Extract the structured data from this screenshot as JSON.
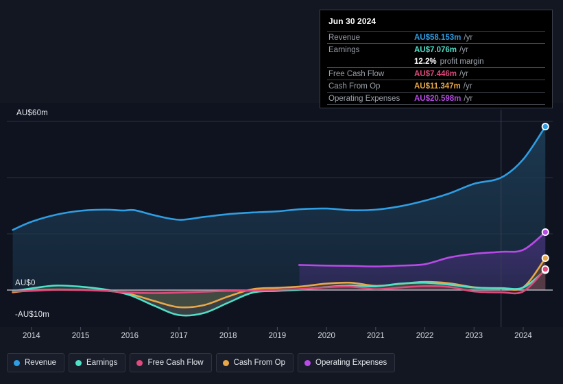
{
  "chart_data": {
    "type": "area",
    "title": "",
    "xlabel": "",
    "ylabel": "",
    "currency": "AU$",
    "unit": "m",
    "grid": true,
    "legend_position": "bottom",
    "xlim": [
      2013.5,
      2024.6
    ],
    "ylim": [
      -13,
      62
    ],
    "x_ticks": [
      "2014",
      "2015",
      "2016",
      "2017",
      "2018",
      "2019",
      "2020",
      "2021",
      "2022",
      "2023",
      "2024"
    ],
    "x_tick_values": [
      2014,
      2015,
      2016,
      2017,
      2018,
      2019,
      2020,
      2021,
      2022,
      2023,
      2024
    ],
    "y_ticks": [
      "AU$60m",
      "AU$0",
      "-AU$10m"
    ],
    "y_tick_values": [
      60,
      0,
      -10
    ],
    "gridlines": [
      60,
      40,
      20,
      0
    ],
    "forecast_divider_x": 2023.55,
    "series": [
      {
        "name": "Revenue",
        "color": "#2f9ee3",
        "fill": "#1c3a52",
        "x": [
          2013.62,
          2014.0,
          2014.5,
          2015.0,
          2015.5,
          2015.85,
          2016.1,
          2016.5,
          2017.0,
          2017.5,
          2018.0,
          2018.5,
          2019.0,
          2019.5,
          2020.0,
          2020.5,
          2021.0,
          2021.5,
          2022.0,
          2022.5,
          2023.0,
          2023.55,
          2024.0,
          2024.45
        ],
        "values": [
          21.4,
          24.3,
          26.8,
          28.2,
          28.6,
          28.3,
          28.4,
          26.6,
          25.0,
          26.0,
          27.0,
          27.6,
          28.0,
          28.8,
          29.0,
          28.4,
          28.6,
          29.8,
          31.8,
          34.4,
          37.8,
          40.0,
          46.5,
          58.153
        ]
      },
      {
        "name": "Earnings",
        "color": "#4fe0c8",
        "fill": "#2a5a58",
        "x": [
          2013.62,
          2014.0,
          2014.5,
          2015.0,
          2015.5,
          2016.0,
          2016.5,
          2017.0,
          2017.5,
          2018.0,
          2018.5,
          2019.0,
          2019.5,
          2020.0,
          2020.5,
          2021.0,
          2021.5,
          2022.0,
          2022.5,
          2023.0,
          2023.55,
          2024.0,
          2024.45
        ],
        "values": [
          -0.4,
          0.6,
          1.6,
          1.2,
          0.2,
          -1.8,
          -5.6,
          -8.9,
          -8.2,
          -4.5,
          -0.9,
          -0.3,
          0.2,
          1.1,
          1.6,
          1.3,
          2.3,
          2.6,
          1.9,
          0.9,
          0.7,
          0.9,
          7.076
        ]
      },
      {
        "name": "Free Cash Flow",
        "color": "#e04a7c",
        "fill": "#6b2a44",
        "x": [
          2013.62,
          2014.0,
          2014.5,
          2015.0,
          2015.5,
          2016.0,
          2016.5,
          2017.0,
          2017.5,
          2018.0,
          2018.5,
          2019.0,
          2019.5,
          2020.0,
          2020.5,
          2021.0,
          2021.5,
          2022.0,
          2022.5,
          2023.0,
          2023.55,
          2024.0,
          2024.45
        ],
        "values": [
          -0.5,
          -0.3,
          0.1,
          0.0,
          -0.3,
          -0.9,
          -1.1,
          -0.9,
          -0.6,
          -0.3,
          -0.2,
          0.1,
          0.4,
          1.0,
          1.2,
          0.3,
          0.9,
          1.4,
          1.1,
          -0.5,
          -0.8,
          -0.5,
          7.446
        ]
      },
      {
        "name": "Cash From Op",
        "color": "#e8a84a",
        "fill": "#6b5225",
        "x": [
          2013.62,
          2014.0,
          2014.5,
          2015.0,
          2015.5,
          2016.0,
          2016.5,
          2017.0,
          2017.5,
          2018.0,
          2018.5,
          2019.0,
          2019.5,
          2020.0,
          2020.5,
          2021.0,
          2021.5,
          2022.0,
          2022.5,
          2023.0,
          2023.55,
          2024.0,
          2024.45
        ],
        "values": [
          -0.8,
          -0.1,
          0.2,
          0.1,
          -0.2,
          -1.4,
          -3.9,
          -6.1,
          -5.4,
          -2.3,
          0.3,
          0.8,
          1.3,
          2.3,
          2.6,
          1.5,
          2.2,
          2.9,
          2.4,
          1.0,
          0.6,
          1.0,
          11.347
        ]
      },
      {
        "name": "Operating Expenses",
        "color": "#b94ae8",
        "fill": "#3e2f6e",
        "x": [
          2019.45,
          2019.5,
          2020.0,
          2020.5,
          2021.0,
          2021.5,
          2022.0,
          2022.5,
          2023.0,
          2023.55,
          2024.0,
          2024.45
        ],
        "values": [
          8.9,
          8.9,
          8.7,
          8.6,
          8.4,
          8.7,
          9.2,
          11.6,
          12.9,
          13.6,
          14.3,
          20.598
        ]
      }
    ]
  },
  "tooltip": {
    "date": "Jun 30 2024",
    "rows": [
      {
        "label": "Revenue",
        "value": "AU$58.153m",
        "unit": "/yr",
        "suffix": "",
        "color": "#2f9ee3"
      },
      {
        "label": "Earnings",
        "value": "AU$7.076m",
        "unit": "/yr",
        "suffix": "",
        "color": "#4fe0c8"
      },
      {
        "label": "",
        "value": "12.2%",
        "unit": "",
        "suffix": "profit margin",
        "color": "#ffffff"
      },
      {
        "label": "Free Cash Flow",
        "value": "AU$7.446m",
        "unit": "/yr",
        "suffix": "",
        "color": "#e04a7c"
      },
      {
        "label": "Cash From Op",
        "value": "AU$11.347m",
        "unit": "/yr",
        "suffix": "",
        "color": "#e8a84a"
      },
      {
        "label": "Operating Expenses",
        "value": "AU$20.598m",
        "unit": "/yr",
        "suffix": "",
        "color": "#b94ae8"
      }
    ]
  },
  "legend": {
    "items": [
      {
        "label": "Revenue",
        "color": "#2f9ee3"
      },
      {
        "label": "Earnings",
        "color": "#4fe0c8"
      },
      {
        "label": "Free Cash Flow",
        "color": "#e04a7c"
      },
      {
        "label": "Cash From Op",
        "color": "#e8a84a"
      },
      {
        "label": "Operating Expenses",
        "color": "#b94ae8"
      }
    ]
  },
  "colors": {
    "background": "#131722",
    "plot_background": "#0f1320",
    "zero_line": "#c9ccd2",
    "grid": "#2b3040",
    "negative_fill": "#5a2530"
  }
}
